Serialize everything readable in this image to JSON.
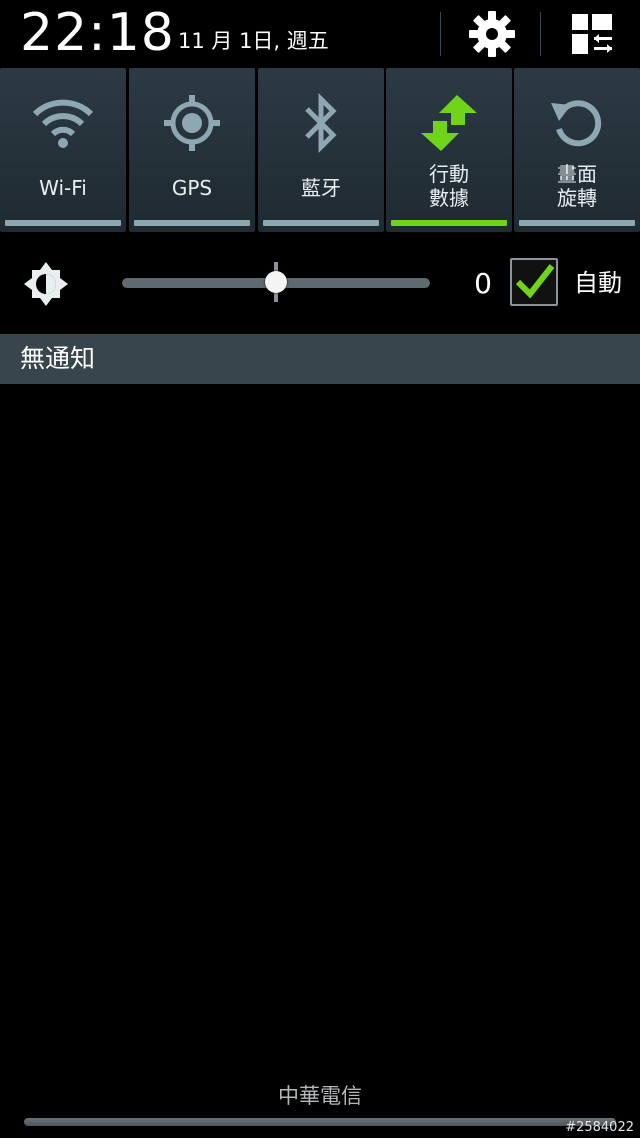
{
  "status": {
    "time": "22:18",
    "date": "11 月 1日, 週五"
  },
  "header_buttons": {
    "settings_icon": "gear-icon",
    "multiwindow_icon": "grid-switch-icon"
  },
  "toggles": [
    {
      "label": "Wi-Fi",
      "icon": "wifi-icon",
      "on": false
    },
    {
      "label": "GPS",
      "icon": "gps-icon",
      "on": false
    },
    {
      "label": "藍牙",
      "icon": "bluetooth-icon",
      "on": false
    },
    {
      "label": "行動\n數據",
      "icon": "mobile-data-icon",
      "on": true
    },
    {
      "label": "畫面\n旋轉",
      "icon": "rotate-icon",
      "on": false
    }
  ],
  "brightness": {
    "icon": "brightness-icon",
    "level_fraction": 0.5,
    "value": "0",
    "auto_checked": true,
    "auto_label": "自動"
  },
  "notifications": {
    "empty_text": "無通知"
  },
  "carrier": "中華電信",
  "watermark": "#2584022",
  "colors": {
    "accent_green": "#6fd41a",
    "toggle_off_bar": "#8ea7b3",
    "notif_bar_bg": "#38454d"
  }
}
